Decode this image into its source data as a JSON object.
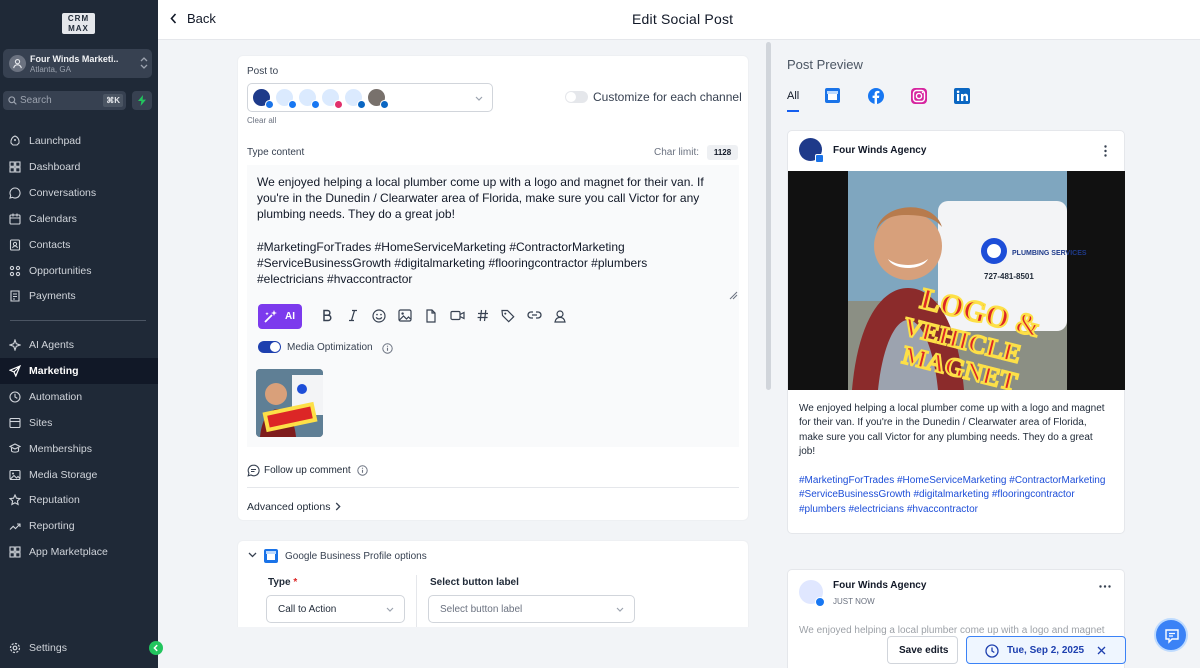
{
  "sidebar": {
    "logo_top": "CRM",
    "logo_bottom": "MAX",
    "account_name": "Four Winds Marketi...",
    "account_location": "Atlanta, GA",
    "search_placeholder": "Search",
    "search_shortcut": "⌘K",
    "items": [
      {
        "label": "Launchpad",
        "icon": "rocket-icon"
      },
      {
        "label": "Dashboard",
        "icon": "dashboard-icon"
      },
      {
        "label": "Conversations",
        "icon": "chat-icon"
      },
      {
        "label": "Calendars",
        "icon": "calendar-icon"
      },
      {
        "label": "Contacts",
        "icon": "contacts-icon"
      },
      {
        "label": "Opportunities",
        "icon": "opportunities-icon"
      },
      {
        "label": "Payments",
        "icon": "payments-icon"
      }
    ],
    "items2": [
      {
        "label": "AI Agents",
        "icon": "ai-agents-icon"
      },
      {
        "label": "Marketing",
        "icon": "send-icon",
        "active": true
      },
      {
        "label": "Automation",
        "icon": "automation-icon"
      },
      {
        "label": "Sites",
        "icon": "sites-icon"
      },
      {
        "label": "Memberships",
        "icon": "memberships-icon"
      },
      {
        "label": "Media Storage",
        "icon": "media-icon"
      },
      {
        "label": "Reputation",
        "icon": "star-icon"
      },
      {
        "label": "Reporting",
        "icon": "reporting-icon"
      },
      {
        "label": "App Marketplace",
        "icon": "apps-icon"
      }
    ],
    "settings": "Settings"
  },
  "topbar": {
    "back": "Back",
    "title": "Edit Social Post"
  },
  "editor": {
    "post_to_label": "Post to",
    "clear_all": "Clear all",
    "customize_label": "Customize for each channel",
    "type_content_label": "Type content",
    "char_limit_label": "Char limit:",
    "char_limit_value": "1128",
    "paragraph1": "We enjoyed helping a local plumber come up with a logo and magnet for their van. If you're in the Dunedin / Clearwater area of Florida, make sure you call Victor for any plumbing needs. They do a great job!",
    "paragraph2": " #MarketingForTrades #HomeServiceMarketing #ContractorMarketing #ServiceBusinessGrowth #digitalmarketing #flooringcontractor #plumbers #electricians #hvaccontractor",
    "ai_label": "AI",
    "media_opt_label": "Media Optimization",
    "follow_up": "Follow up comment",
    "advanced": "Advanced options"
  },
  "gbp": {
    "title": "Google Business Profile options",
    "type_label": "Type",
    "required_mark": "*",
    "type_value": "Call to Action",
    "button_label": "Select button label",
    "button_placeholder": "Select button label"
  },
  "preview": {
    "title": "Post Preview",
    "tab_all": "All",
    "account": "Four Winds Agency",
    "just_now": "JUST NOW",
    "post_text": "We enjoyed helping a local plumber come up with a logo and magnet for their van. If you're in the Dunedin / Clearwater area of Florida, make sure you call Victor for any plumbing needs. They do a great job!",
    "post_tags": " #MarketingForTrades #HomeServiceMarketing #ContractorMarketing #ServiceBusinessGrowth #digitalmarketing #flooringcontractor #plumbers #electricians #hvaccontractor",
    "img_line1": "LOGO &",
    "img_line2": "VEHICLE",
    "img_line3": "MAGNET",
    "van_company": "PLUMBING SERVICES",
    "van_phone": "727-481-8501",
    "footer_partial": "We enjoyed helping a local plumber come up with a logo and magnet"
  },
  "footer": {
    "save": "Save edits",
    "date": "Tue, Sep 2, 2025"
  },
  "colors": {
    "sidebar": "#1f2937",
    "accent": "#155eef",
    "ai": "#7c3aed",
    "toggle_on": "#1e40af"
  }
}
